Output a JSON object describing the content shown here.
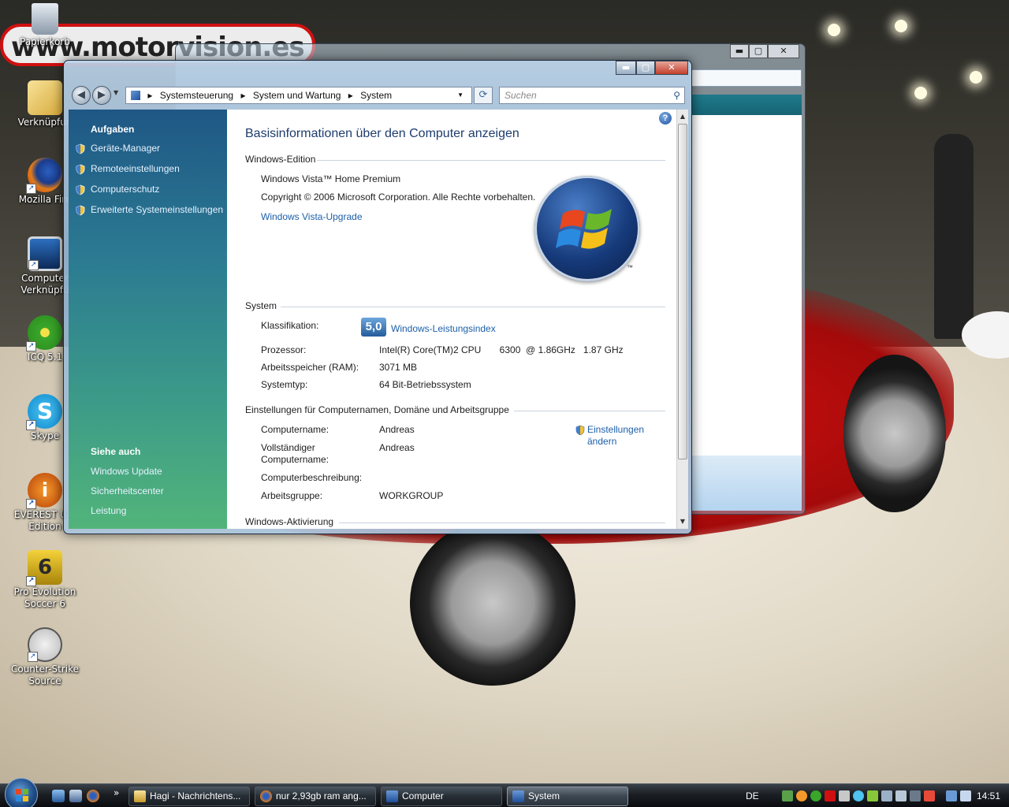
{
  "desktop": {
    "banner_text": "www.motorvision.es",
    "icons": [
      {
        "label": "Papierkorb"
      },
      {
        "label": "Verknüpfun"
      },
      {
        "label": "Mozilla Fire"
      },
      {
        "label": "Computer Verknüpfu"
      },
      {
        "label": "ICQ 5.1"
      },
      {
        "label": "Skype"
      },
      {
        "label": "EVEREST Ulti Edition"
      },
      {
        "label": "Pro Evolution Soccer 6"
      },
      {
        "label": "Counter-Strike Source"
      }
    ]
  },
  "window": {
    "controls": {
      "minimize": "▬",
      "maximize": "▢",
      "close": "✕"
    },
    "address": [
      "Systemsteuerung",
      "System und Wartung",
      "System"
    ],
    "search_placeholder": "Suchen",
    "sidebar": {
      "tasks_header": "Aufgaben",
      "tasks": [
        "Geräte-Manager",
        "Remoteeinstellungen",
        "Computerschutz",
        "Erweiterte Systemeinstellungen"
      ],
      "see_also_header": "Siehe auch",
      "see_also": [
        "Windows Update",
        "Sicherheitscenter",
        "Leistung"
      ]
    },
    "content": {
      "title": "Basisinformationen über den Computer anzeigen",
      "edition": {
        "header": "Windows-Edition",
        "name": "Windows Vista™ Home Premium",
        "copyright": "Copyright © 2006 Microsoft Corporation. Alle Rechte vorbehalten.",
        "upgrade_link": "Windows Vista-Upgrade"
      },
      "system": {
        "header": "System",
        "rating_label": "Klassifikation:",
        "rating_value": "5,0",
        "rating_link": "Windows-Leistungsindex",
        "cpu_label": "Prozessor:",
        "cpu_value": "Intel(R) Core(TM)2 CPU       6300  @ 1.86GHz   1.87 GHz",
        "ram_label": "Arbeitsspeicher (RAM):",
        "ram_value": "3071 MB",
        "type_label": "Systemtyp:",
        "type_value": "64 Bit-Betriebssystem"
      },
      "computer_name": {
        "header": "Einstellungen für Computernamen, Domäne und Arbeitsgruppe",
        "name_label": "Computername:",
        "name_value": "Andreas",
        "full_label_1": "Vollständiger",
        "full_label_2": "Computername:",
        "full_value": "Andreas",
        "desc_label": "Computerbeschreibung:",
        "group_label": "Arbeitsgruppe:",
        "group_value": "WORKGROUP",
        "change_link_1": "Einstellungen",
        "change_link_2": "ändern"
      },
      "activation_header": "Windows-Aktivierung",
      "logo_tm": "™"
    }
  },
  "taskbar": {
    "tasks": [
      "Hagi - Nachrichtens...",
      "nur 2,93gb ram ang...",
      "Computer",
      "System"
    ],
    "active_task": "System",
    "language": "DE",
    "clock": "14:51",
    "more": "»"
  },
  "colors": {
    "accent": "#1c5fa8",
    "title_blue": "#1e3c6e",
    "sidebar_top": "#1f5785",
    "sidebar_bottom": "#52b47a"
  }
}
